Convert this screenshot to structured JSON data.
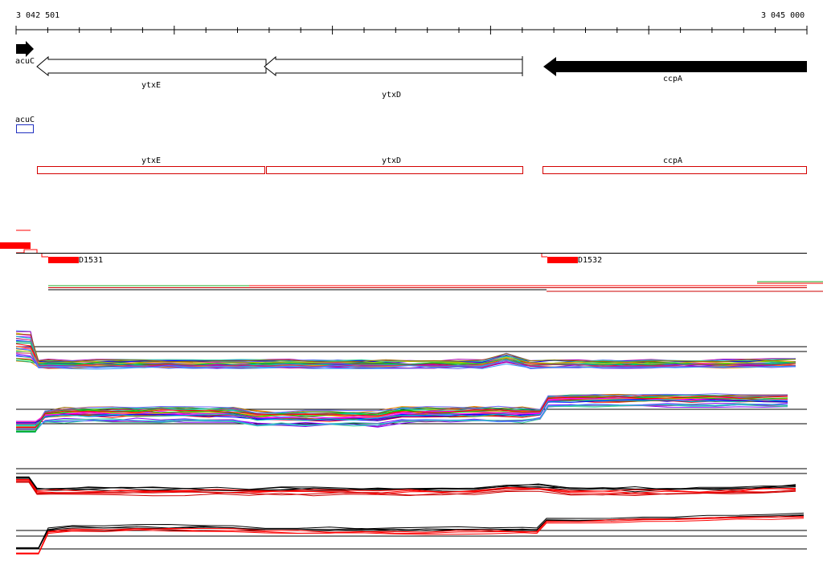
{
  "ruler": {
    "start_label": "3 042 501",
    "end_label": "3 045 000"
  },
  "genes": {
    "acuC": "acuC",
    "ytxE": "ytxE",
    "ytxD": "ytxD",
    "ccpA": "ccpA"
  },
  "annotation_track": {
    "acuC": "acuC",
    "ytxE": "ytxE",
    "ytxD": "ytxD",
    "ccpA": "ccpA"
  },
  "features": {
    "feature_1": "D1531",
    "feature_2": "D1532"
  },
  "colors": {
    "gene_arrow_filled": "#000000",
    "annotation_box": "#d40000",
    "acuC_box": "#2030c0",
    "feature_block": "#ff0000"
  },
  "icons": {
    "gene_forward": "filled-arrow-right",
    "gene_reverse_outline": "outline-arrow-left",
    "gene_reverse_filled": "filled-arrow-left"
  }
}
